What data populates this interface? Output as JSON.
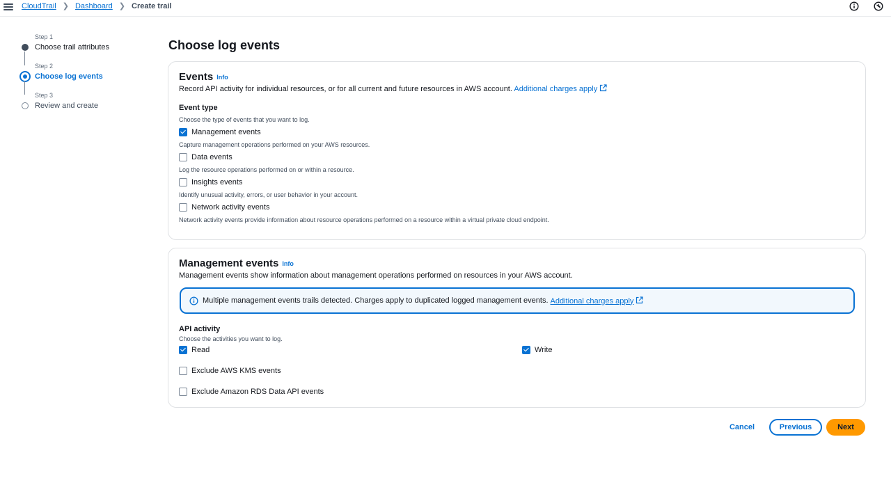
{
  "breadcrumb": {
    "items": [
      {
        "label": "CloudTrail"
      },
      {
        "label": "Dashboard"
      },
      {
        "label": "Create trail"
      }
    ]
  },
  "steps": [
    {
      "label": "Step 1",
      "title": "Choose trail attributes",
      "state": "done"
    },
    {
      "label": "Step 2",
      "title": "Choose log events",
      "state": "active"
    },
    {
      "label": "Step 3",
      "title": "Review and create",
      "state": "todo"
    }
  ],
  "page_title": "Choose log events",
  "events_panel": {
    "heading": "Events",
    "info": "Info",
    "description": "Record API activity for individual resources, or for all current and future resources in AWS account.",
    "link": "Additional charges apply",
    "event_type_label": "Event type",
    "event_type_desc": "Choose the type of events that you want to log.",
    "options": [
      {
        "label": "Management events",
        "desc": "Capture management operations performed on your AWS resources.",
        "checked": true
      },
      {
        "label": "Data events",
        "desc": "Log the resource operations performed on or within a resource.",
        "checked": false
      },
      {
        "label": "Insights events",
        "desc": "Identify unusual activity, errors, or user behavior in your account.",
        "checked": false
      },
      {
        "label": "Network activity events",
        "desc": "Network activity events provide information about resource operations performed on a resource within a virtual private cloud endpoint.",
        "checked": false
      }
    ]
  },
  "management_panel": {
    "heading": "Management events",
    "info": "Info",
    "description": "Management events show information about management operations performed on resources in your AWS account.",
    "alert_text": "Multiple management events trails detected. Charges apply to duplicated logged management events.",
    "alert_link": "Additional charges apply",
    "api_label": "API activity",
    "api_desc": "Choose the activities you want to log.",
    "read": {
      "label": "Read",
      "checked": true
    },
    "write": {
      "label": "Write",
      "checked": true
    },
    "exclude_kms": {
      "label": "Exclude AWS KMS events",
      "checked": false
    },
    "exclude_rds": {
      "label": "Exclude Amazon RDS Data API events",
      "checked": false
    }
  },
  "buttons": {
    "cancel": "Cancel",
    "previous": "Previous",
    "next": "Next"
  },
  "colors": {
    "accent": "#0972d3",
    "primary_button": "#ff9900"
  }
}
